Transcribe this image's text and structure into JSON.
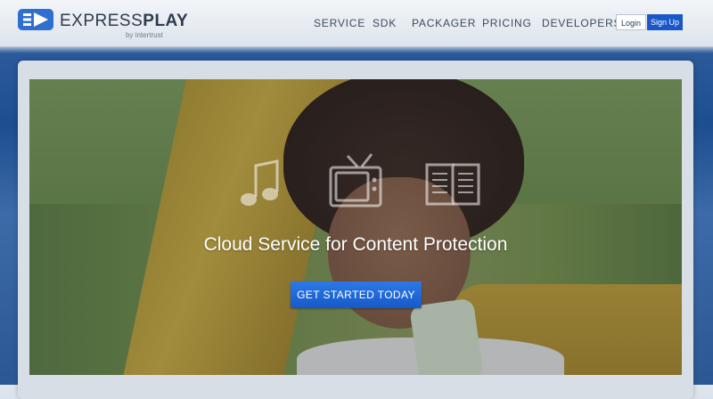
{
  "header": {
    "logo": {
      "brand_thin": "EXPRESS",
      "brand_bold": "PLAY",
      "tagline": "by intertrust",
      "icon": "play-logo-icon"
    },
    "nav": [
      {
        "label": "SERVICE"
      },
      {
        "label": "SDK"
      },
      {
        "label": "PACKAGER"
      },
      {
        "label": "PRICING"
      },
      {
        "label": "DEVELOPERS"
      }
    ],
    "login_label": "Login",
    "signup_label": "Sign Up"
  },
  "hero": {
    "icons": [
      "music-note-icon",
      "tv-icon",
      "book-icon"
    ],
    "title": "Cloud Service for Content Protection",
    "cta_label": "GET STARTED TODAY"
  },
  "colors": {
    "accent": "#1a57c9",
    "header_bg": "#e6ebf1",
    "nav_text": "#3c4a5c"
  }
}
